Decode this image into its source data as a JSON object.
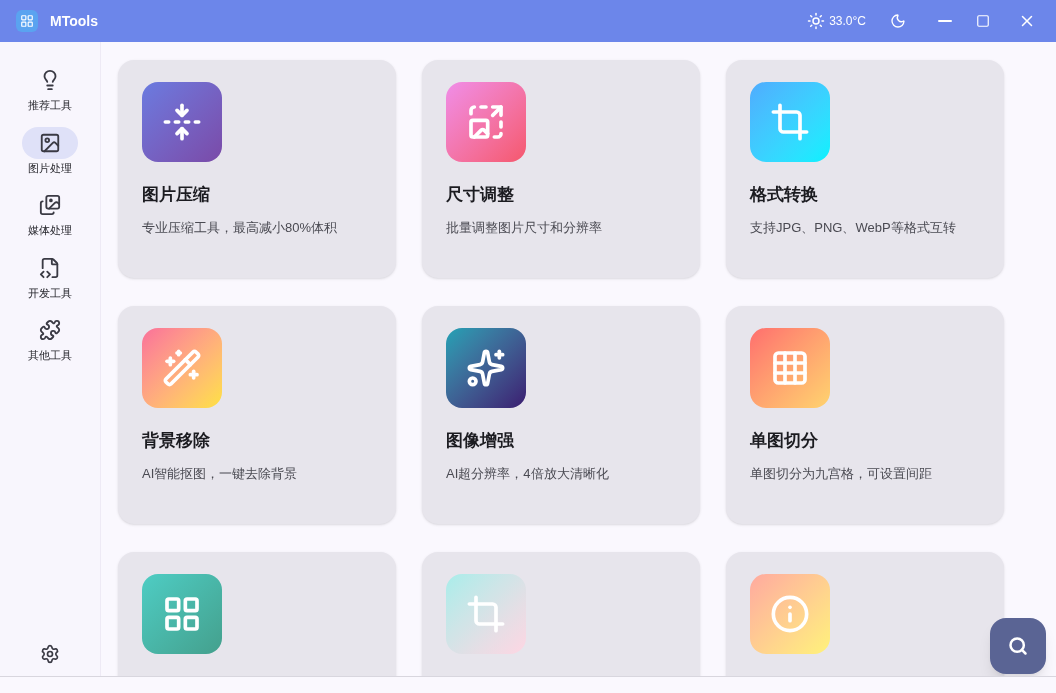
{
  "window": {
    "title": "MTools",
    "weather": "33.0°C"
  },
  "sidebar": {
    "items": [
      {
        "label": "推荐工具",
        "kind": "bulb",
        "selected": false
      },
      {
        "label": "图片处理",
        "kind": "image",
        "selected": true
      },
      {
        "label": "媒体处理",
        "kind": "media",
        "selected": false
      },
      {
        "label": "开发工具",
        "kind": "code",
        "selected": false
      },
      {
        "label": "其他工具",
        "kind": "puzzle",
        "selected": false
      }
    ]
  },
  "tools": [
    {
      "kind": "compress",
      "title": "图片压缩",
      "description": "专业压缩工具，最高减小80%体积"
    },
    {
      "kind": "resize",
      "title": "尺寸调整",
      "description": "批量调整图片尺寸和分辨率"
    },
    {
      "kind": "convert",
      "title": "格式转换",
      "description": "支持JPG、PNG、WebP等格式互转"
    },
    {
      "kind": "background",
      "title": "背景移除",
      "description": "AI智能抠图，一键去除背景"
    },
    {
      "kind": "enhance",
      "title": "图像增强",
      "description": "AI超分辨率，4倍放大清晰化"
    },
    {
      "kind": "slice",
      "title": "单图切分",
      "description": "单图切分为九宫格，可设置间距"
    },
    {
      "kind": "stitch"
    },
    {
      "kind": "crop"
    },
    {
      "kind": "info"
    }
  ]
}
